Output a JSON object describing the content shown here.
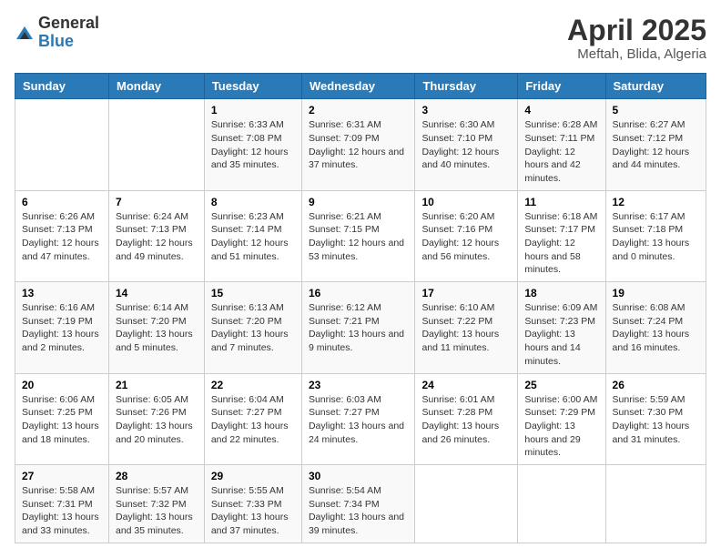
{
  "header": {
    "logo_general": "General",
    "logo_blue": "Blue",
    "title": "April 2025",
    "location": "Meftah, Blida, Algeria"
  },
  "calendar": {
    "days_of_week": [
      "Sunday",
      "Monday",
      "Tuesday",
      "Wednesday",
      "Thursday",
      "Friday",
      "Saturday"
    ],
    "weeks": [
      [
        {
          "day": "",
          "content": ""
        },
        {
          "day": "",
          "content": ""
        },
        {
          "day": "1",
          "content": "Sunrise: 6:33 AM\nSunset: 7:08 PM\nDaylight: 12 hours and 35 minutes."
        },
        {
          "day": "2",
          "content": "Sunrise: 6:31 AM\nSunset: 7:09 PM\nDaylight: 12 hours and 37 minutes."
        },
        {
          "day": "3",
          "content": "Sunrise: 6:30 AM\nSunset: 7:10 PM\nDaylight: 12 hours and 40 minutes."
        },
        {
          "day": "4",
          "content": "Sunrise: 6:28 AM\nSunset: 7:11 PM\nDaylight: 12 hours and 42 minutes."
        },
        {
          "day": "5",
          "content": "Sunrise: 6:27 AM\nSunset: 7:12 PM\nDaylight: 12 hours and 44 minutes."
        }
      ],
      [
        {
          "day": "6",
          "content": "Sunrise: 6:26 AM\nSunset: 7:13 PM\nDaylight: 12 hours and 47 minutes."
        },
        {
          "day": "7",
          "content": "Sunrise: 6:24 AM\nSunset: 7:13 PM\nDaylight: 12 hours and 49 minutes."
        },
        {
          "day": "8",
          "content": "Sunrise: 6:23 AM\nSunset: 7:14 PM\nDaylight: 12 hours and 51 minutes."
        },
        {
          "day": "9",
          "content": "Sunrise: 6:21 AM\nSunset: 7:15 PM\nDaylight: 12 hours and 53 minutes."
        },
        {
          "day": "10",
          "content": "Sunrise: 6:20 AM\nSunset: 7:16 PM\nDaylight: 12 hours and 56 minutes."
        },
        {
          "day": "11",
          "content": "Sunrise: 6:18 AM\nSunset: 7:17 PM\nDaylight: 12 hours and 58 minutes."
        },
        {
          "day": "12",
          "content": "Sunrise: 6:17 AM\nSunset: 7:18 PM\nDaylight: 13 hours and 0 minutes."
        }
      ],
      [
        {
          "day": "13",
          "content": "Sunrise: 6:16 AM\nSunset: 7:19 PM\nDaylight: 13 hours and 2 minutes."
        },
        {
          "day": "14",
          "content": "Sunrise: 6:14 AM\nSunset: 7:20 PM\nDaylight: 13 hours and 5 minutes."
        },
        {
          "day": "15",
          "content": "Sunrise: 6:13 AM\nSunset: 7:20 PM\nDaylight: 13 hours and 7 minutes."
        },
        {
          "day": "16",
          "content": "Sunrise: 6:12 AM\nSunset: 7:21 PM\nDaylight: 13 hours and 9 minutes."
        },
        {
          "day": "17",
          "content": "Sunrise: 6:10 AM\nSunset: 7:22 PM\nDaylight: 13 hours and 11 minutes."
        },
        {
          "day": "18",
          "content": "Sunrise: 6:09 AM\nSunset: 7:23 PM\nDaylight: 13 hours and 14 minutes."
        },
        {
          "day": "19",
          "content": "Sunrise: 6:08 AM\nSunset: 7:24 PM\nDaylight: 13 hours and 16 minutes."
        }
      ],
      [
        {
          "day": "20",
          "content": "Sunrise: 6:06 AM\nSunset: 7:25 PM\nDaylight: 13 hours and 18 minutes."
        },
        {
          "day": "21",
          "content": "Sunrise: 6:05 AM\nSunset: 7:26 PM\nDaylight: 13 hours and 20 minutes."
        },
        {
          "day": "22",
          "content": "Sunrise: 6:04 AM\nSunset: 7:27 PM\nDaylight: 13 hours and 22 minutes."
        },
        {
          "day": "23",
          "content": "Sunrise: 6:03 AM\nSunset: 7:27 PM\nDaylight: 13 hours and 24 minutes."
        },
        {
          "day": "24",
          "content": "Sunrise: 6:01 AM\nSunset: 7:28 PM\nDaylight: 13 hours and 26 minutes."
        },
        {
          "day": "25",
          "content": "Sunrise: 6:00 AM\nSunset: 7:29 PM\nDaylight: 13 hours and 29 minutes."
        },
        {
          "day": "26",
          "content": "Sunrise: 5:59 AM\nSunset: 7:30 PM\nDaylight: 13 hours and 31 minutes."
        }
      ],
      [
        {
          "day": "27",
          "content": "Sunrise: 5:58 AM\nSunset: 7:31 PM\nDaylight: 13 hours and 33 minutes."
        },
        {
          "day": "28",
          "content": "Sunrise: 5:57 AM\nSunset: 7:32 PM\nDaylight: 13 hours and 35 minutes."
        },
        {
          "day": "29",
          "content": "Sunrise: 5:55 AM\nSunset: 7:33 PM\nDaylight: 13 hours and 37 minutes."
        },
        {
          "day": "30",
          "content": "Sunrise: 5:54 AM\nSunset: 7:34 PM\nDaylight: 13 hours and 39 minutes."
        },
        {
          "day": "",
          "content": ""
        },
        {
          "day": "",
          "content": ""
        },
        {
          "day": "",
          "content": ""
        }
      ]
    ]
  }
}
